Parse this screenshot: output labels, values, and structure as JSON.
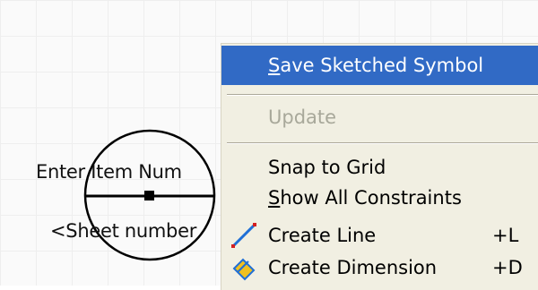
{
  "canvas": {
    "item_text": "Enter Item Num",
    "sheet_text": "<Sheet number"
  },
  "context_menu": {
    "items": [
      {
        "label": "Save Sketched Symbol",
        "state": "selected"
      },
      {
        "label": "Update",
        "state": "disabled"
      },
      {
        "label": "Snap to Grid",
        "state": "normal"
      },
      {
        "label": "Show All Constraints",
        "state": "normal"
      },
      {
        "label": "Create Line",
        "shortcut": "+L",
        "icon": "line-icon",
        "state": "normal"
      },
      {
        "label": "Create Dimension",
        "shortcut": "+D",
        "icon": "dimension-icon",
        "state": "normal"
      }
    ]
  },
  "colors": {
    "selection": "#316ac5",
    "menu_background": "#f1efe2",
    "disabled_text": "#a8a89a"
  }
}
